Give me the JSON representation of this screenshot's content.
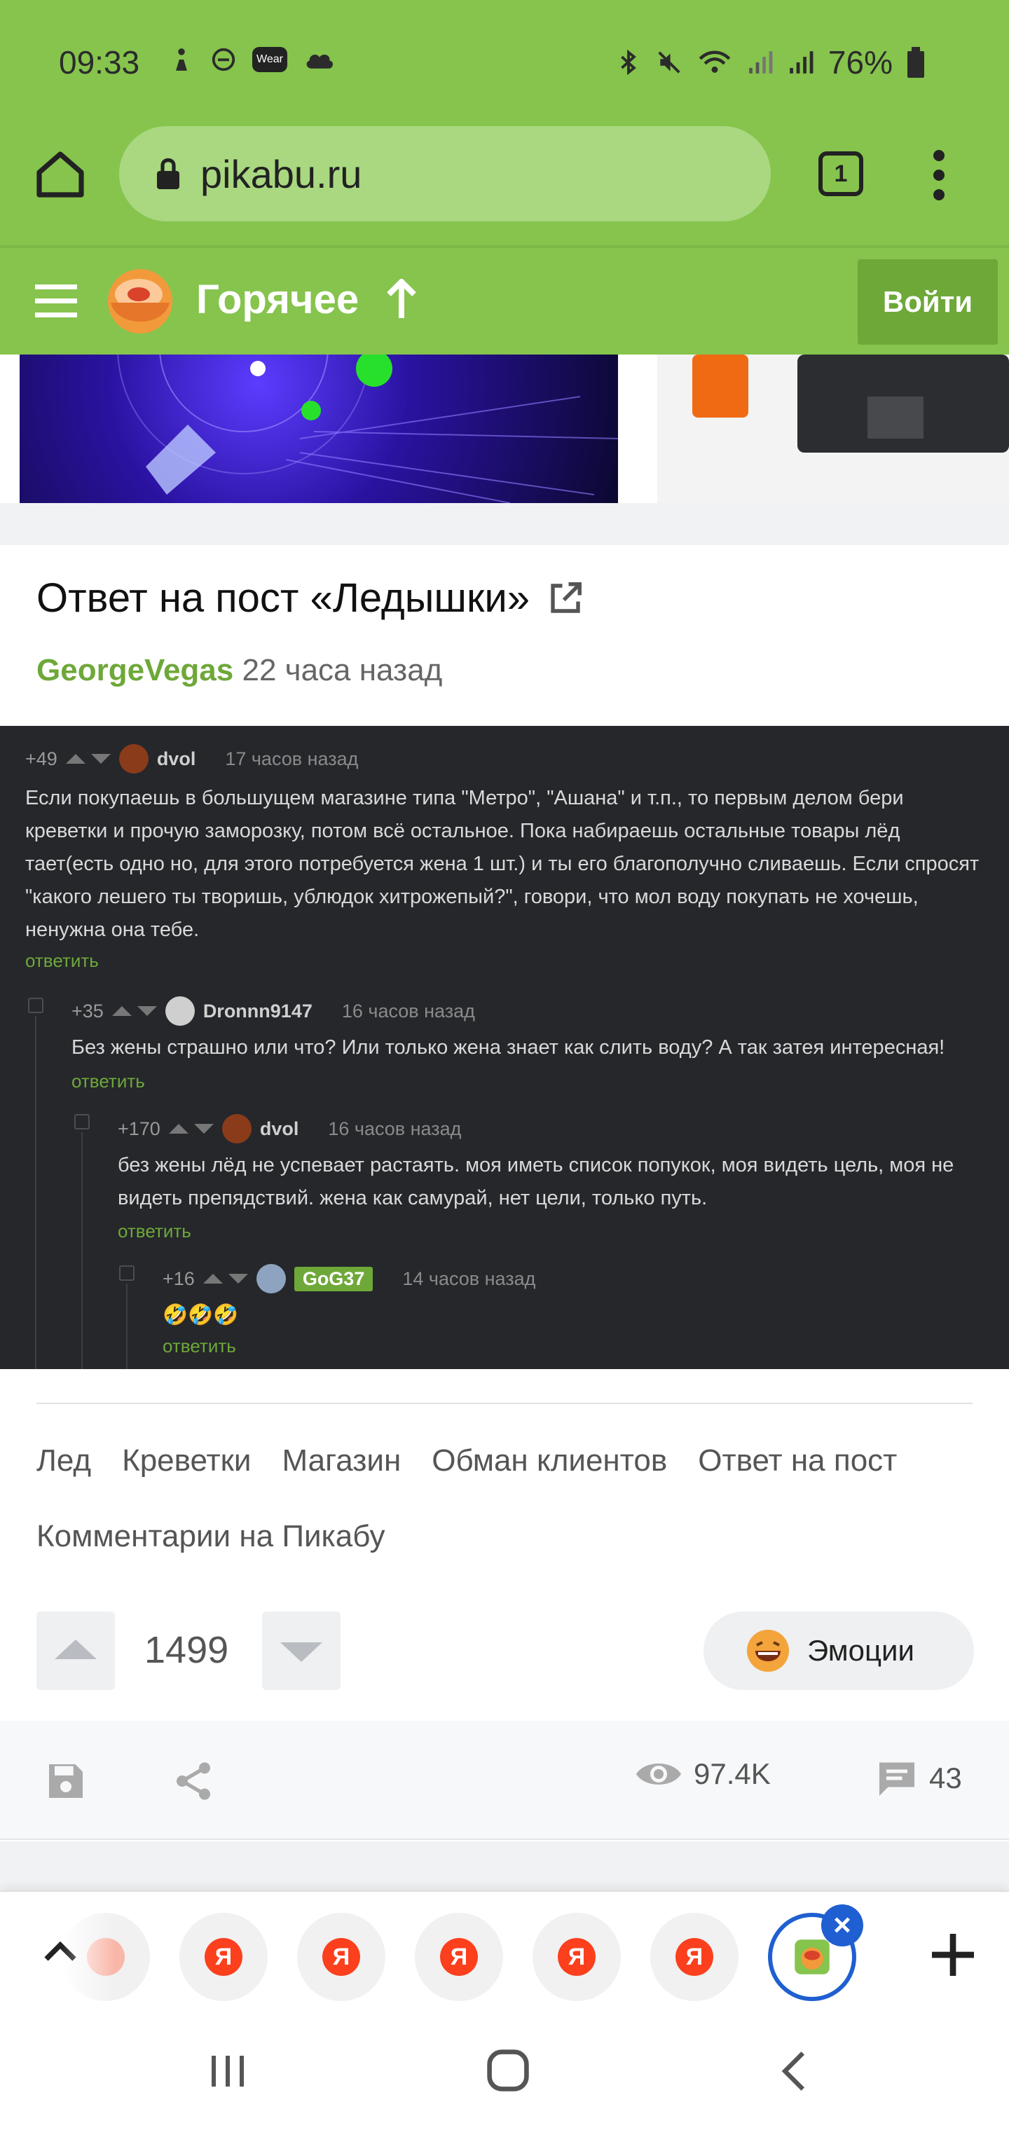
{
  "status_bar": {
    "time": "09:33",
    "battery": "76%",
    "icons": [
      "steps-icon",
      "dnd-icon",
      "wear-icon",
      "cloud-icon",
      "bluetooth-icon",
      "mute-icon",
      "wifi-icon",
      "signal-icon",
      "signal-icon",
      "battery-icon"
    ],
    "wear_label": "Wear"
  },
  "browser": {
    "url": "pikabu.ru",
    "tab_count": "1"
  },
  "site_header": {
    "section": "Горячее",
    "login_label": "Войти"
  },
  "post": {
    "title": "Ответ на пост «Ледышки»",
    "author": "GeorgeVegas",
    "time": "22 часа назад",
    "tags": [
      "Лед",
      "Креветки",
      "Магазин",
      "Обман клиентов",
      "Ответ на пост",
      "Комментарии на Пикабу"
    ],
    "rating": "1499",
    "emotions_label": "Эмоции",
    "views": "97.4K",
    "comments_count": "43"
  },
  "comments_image": {
    "comments": [
      {
        "score": "+49",
        "user": "dvol",
        "time": "17 часов назад",
        "text": "Если покупаешь в большущем магазине типа \"Метро\", \"Ашана\" и т.п., то первым делом бери креветки и прочую заморозку, потом всё остальное. Пока набираешь остальные товары лёд тает(есть одно но, для этого потребуется жена 1 шт.) и ты его благополучно сливаешь. Если спросят \"какого лешего ты творишь, ублюдок хитрожепый?\", говори, что мол воду покупать не хочешь, ненужна она тебе.",
        "reply": "ответить"
      },
      {
        "score": "+35",
        "user": "Dronnn9147",
        "time": "16 часов назад",
        "text": "Без жены страшно или что? Или только жена знает как слить воду? А так затея интересная!",
        "reply": "ответить"
      },
      {
        "score": "+170",
        "user": "dvol",
        "time": "16 часов назад",
        "text": "без жены лёд не успевает растаять. моя иметь список попукок, моя видеть цель, моя не видеть препядствий. жена как самурай, нет цели, только путь.",
        "reply": "ответить"
      },
      {
        "score": "+16",
        "user": "GoG37",
        "time": "14 часов назад",
        "text": "🤣🤣🤣",
        "reply": "ответить"
      }
    ]
  },
  "tab_strip": {
    "tab_letter": "Я"
  }
}
